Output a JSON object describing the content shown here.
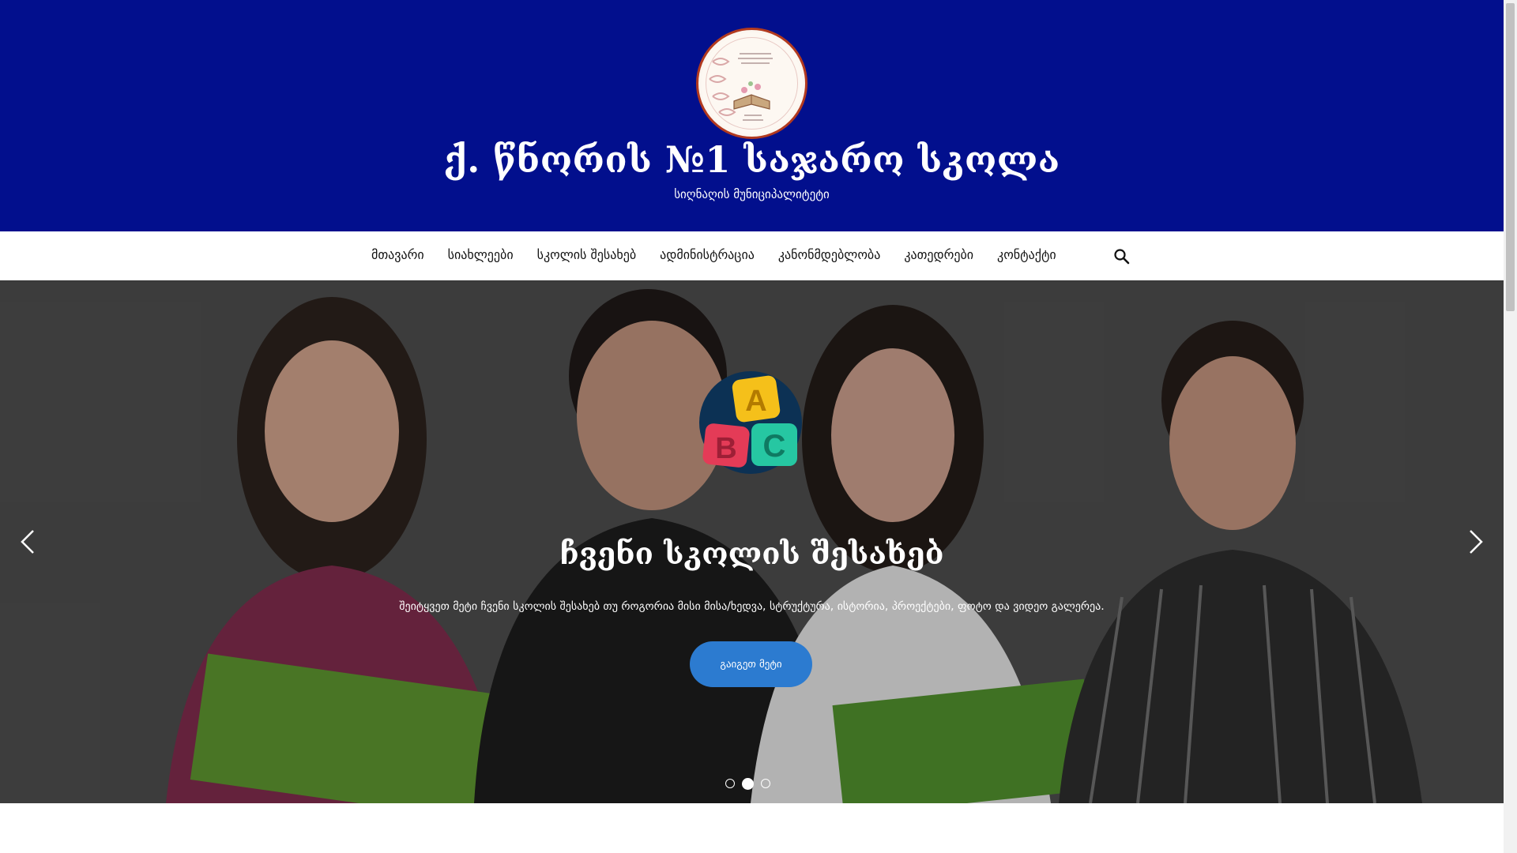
{
  "header": {
    "title": "ქ. წნორის №1 საჯარო სკოლა",
    "subtitle": "სიღნაღის მუნიციპალიტეტი",
    "logo_icon": "school-emblem-icon",
    "background_color": "#020f8d"
  },
  "nav": {
    "items": [
      {
        "label": "მთავარი"
      },
      {
        "label": "სიახლეები"
      },
      {
        "label": "სკოლის შესახებ"
      },
      {
        "label": "ადმინისტრაცია"
      },
      {
        "label": "კანონმდებლობა"
      },
      {
        "label": "კათედრები"
      },
      {
        "label": "კონტაქტი"
      }
    ],
    "search_icon": "search-icon"
  },
  "slider": {
    "title": "ჩვენი სკოლის შესახებ",
    "text": "შეიტყვეთ მეტი ჩვენი სკოლის შესახებ თუ როგორია მისი მისა/ხედვა, სტრუქტურა, ისტორია, პროექტები, ფოტო და ვიდეო გალერეა.",
    "button_label": "გაიგეთ მეტი",
    "button_color": "#2c7bd0",
    "icon": "abc-blocks-icon",
    "current_slide": 2,
    "total_slides": 3
  }
}
